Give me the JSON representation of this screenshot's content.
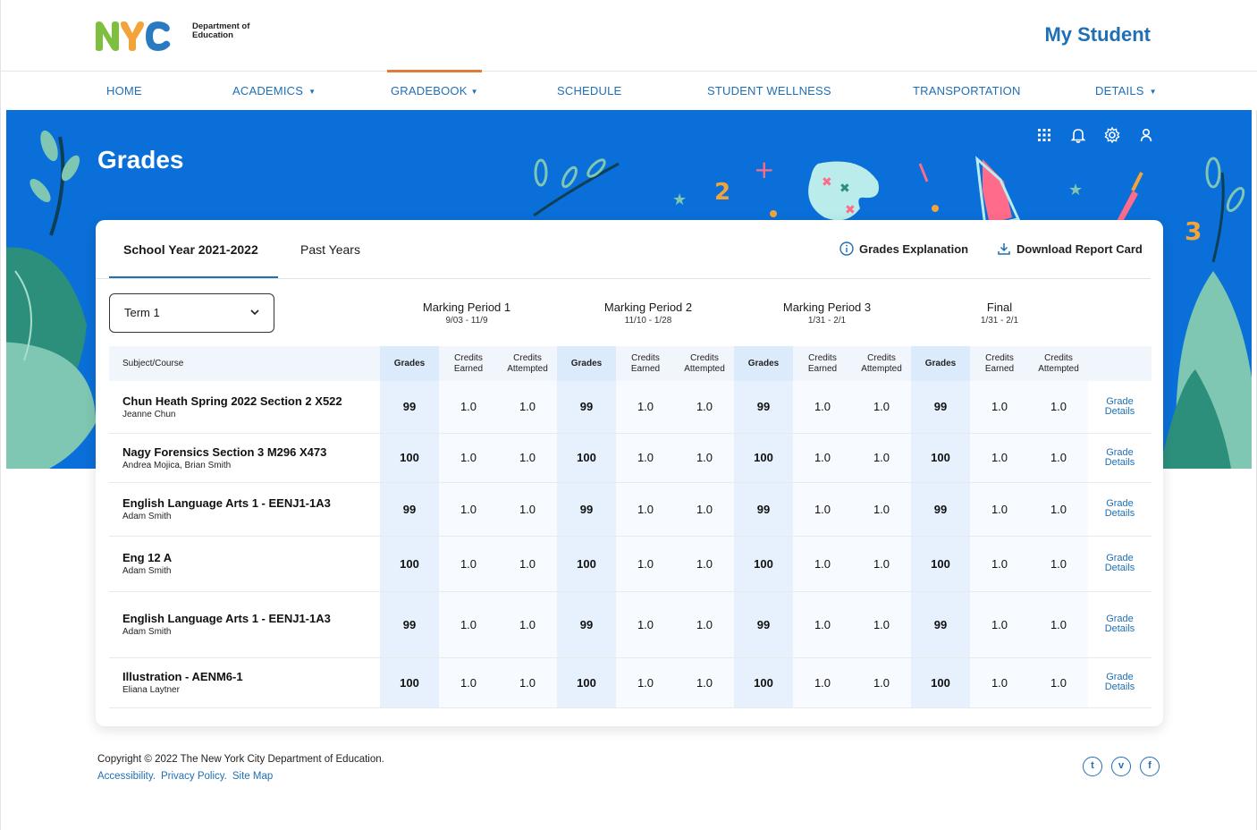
{
  "header": {
    "logo_letters": "NYC",
    "logo_text": "Department of Education",
    "app_title": "My Student"
  },
  "nav": [
    {
      "label": "HOME"
    },
    {
      "label": "ACADEMICS",
      "caret": "▼"
    },
    {
      "label": "GRADEBOOK",
      "caret": "▼"
    },
    {
      "label": "SCHEDULE"
    },
    {
      "label": "STUDENT WELLNESS"
    },
    {
      "label": "TRANSPORTATION"
    },
    {
      "label": "DETAILS",
      "caret": "▼"
    }
  ],
  "hero": {
    "title": "Grades",
    "icons": [
      "apps-grid-icon",
      "bell-icon",
      "gear-icon",
      "user-icon"
    ]
  },
  "tabs": [
    {
      "label": "School Year 2021-2022",
      "active": true
    },
    {
      "label": "Past Years",
      "active": false
    }
  ],
  "actions": {
    "explanation": "Grades Explanation",
    "download": "Download Report Card"
  },
  "term_select": {
    "value": "Term 1"
  },
  "periods": [
    {
      "title": "Marking Period 1",
      "dates": "9/03 - 11/9"
    },
    {
      "title": "Marking Period 2",
      "dates": "11/10 - 1/28"
    },
    {
      "title": "Marking Period 3",
      "dates": "1/31 - 2/1"
    },
    {
      "title": "Final",
      "dates": "1/31 - 2/1"
    }
  ],
  "table": {
    "subject_header": "Subject/Course",
    "grades_header": "Grades",
    "earned_header": "Credits Earned",
    "attempted_header": "Credits Attempted",
    "details_label": "Grade Details",
    "rows": [
      {
        "course": "Chun Heath Spring 2022 Section 2 X522",
        "teacher": "Jeanne Chun",
        "grade": "99",
        "earned": "1.0",
        "attempted": "1.0"
      },
      {
        "course": "Nagy Forensics Section 3 M296 X473",
        "teacher": "Andrea Mojica, Brian Smith",
        "grade": "100",
        "earned": "1.0",
        "attempted": "1.0"
      },
      {
        "course": "English Language Arts 1 - EENJ1-1A3",
        "teacher": "Adam Smith",
        "grade": "99",
        "earned": "1.0",
        "attempted": "1.0"
      },
      {
        "course": "Eng 12 A",
        "teacher": "Adam Smith",
        "grade": "100",
        "earned": "1.0",
        "attempted": "1.0"
      },
      {
        "course": "English Language Arts 1 - EENJ1-1A3",
        "teacher": "Adam Smith",
        "grade": "99",
        "earned": "1.0",
        "attempted": "1.0"
      },
      {
        "course": "Illustration - AENM6-1",
        "teacher": "Eliana Laytner",
        "grade": "100",
        "earned": "1.0",
        "attempted": "1.0"
      }
    ]
  },
  "footer": {
    "copyright": "Copyright © 2022 The New York City Department of Education.",
    "links": [
      "Accessibility.",
      "Privacy Policy.",
      "Site Map"
    ],
    "social": [
      "twitter-icon",
      "vimeo-icon",
      "facebook-icon"
    ]
  },
  "colors": {
    "brand_blue": "#1f6fb5",
    "hero_blue": "#0a6fd8",
    "active_tab_orange": "#e07b39"
  }
}
